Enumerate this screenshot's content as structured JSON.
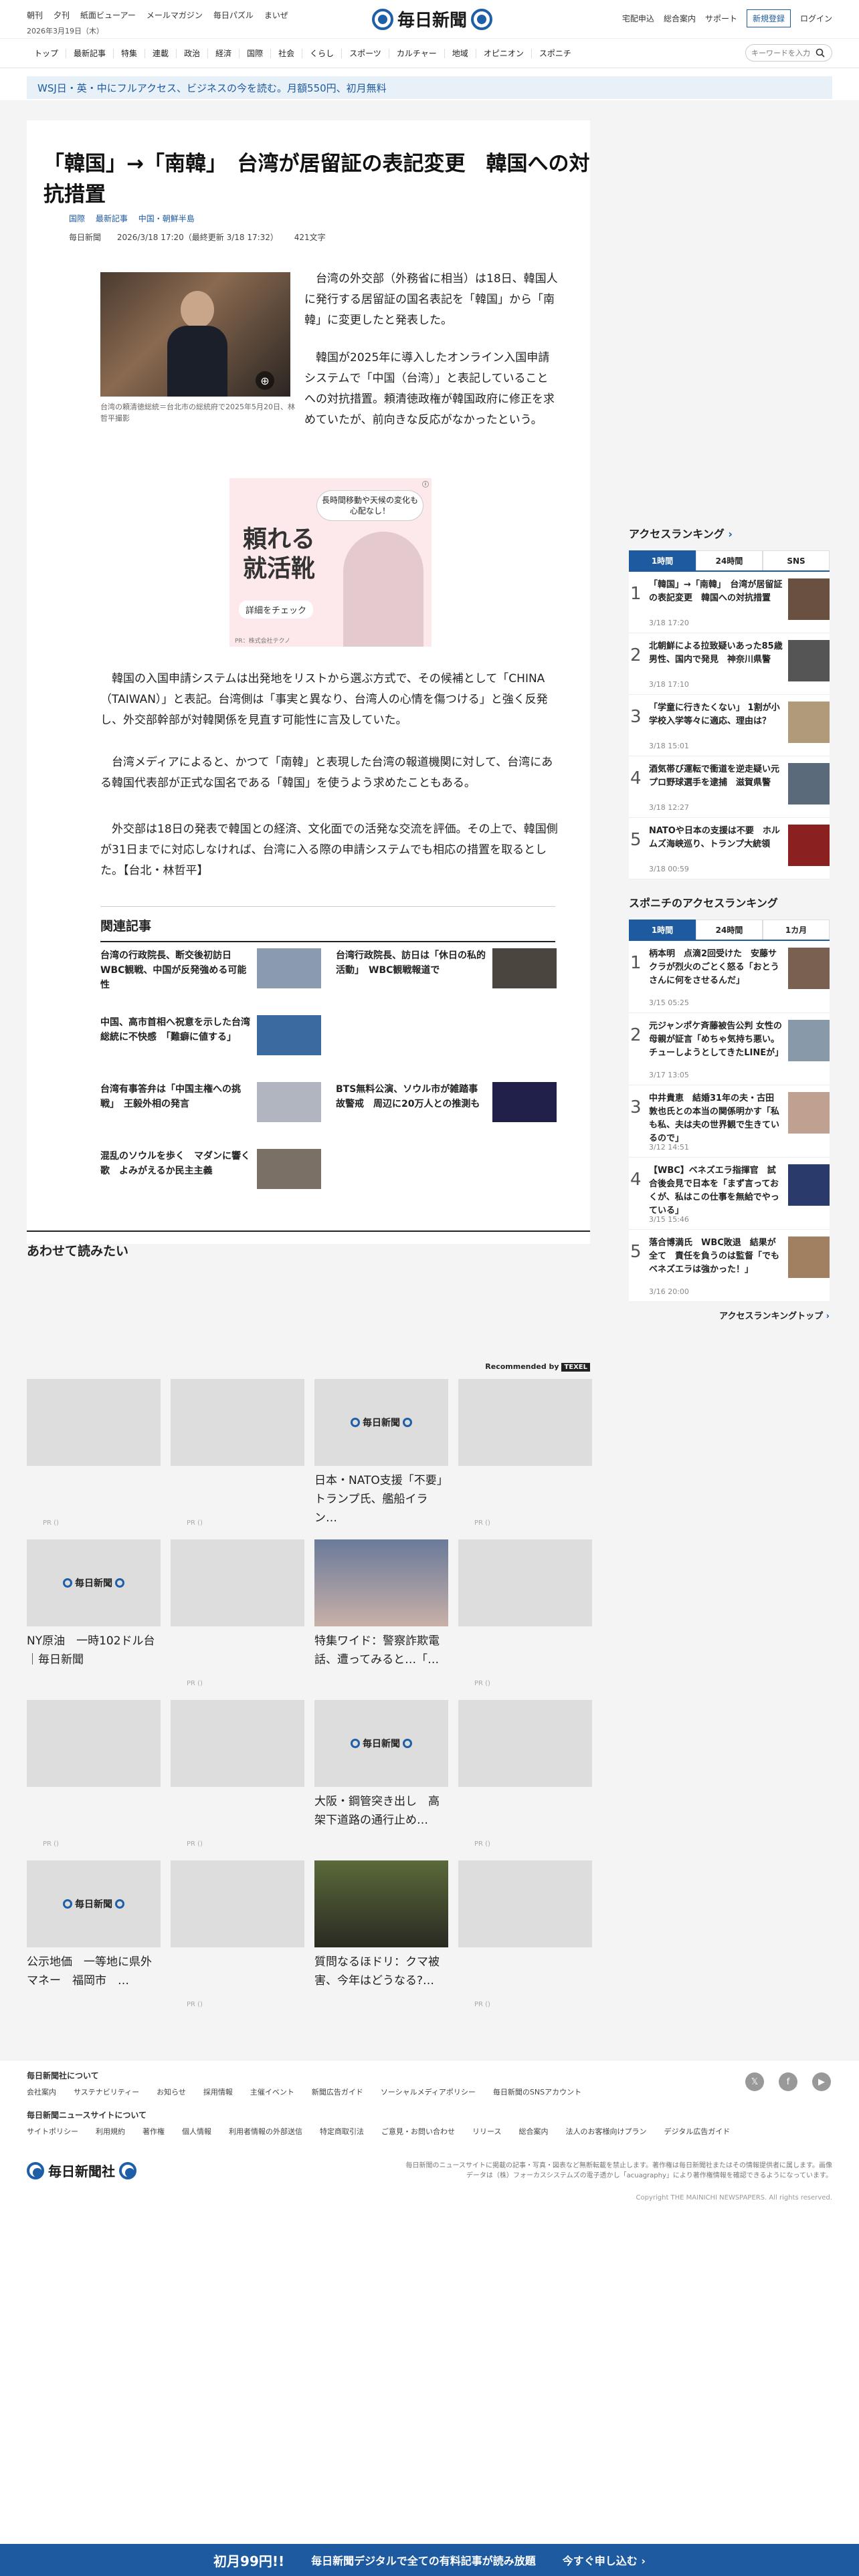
{
  "header": {
    "left_links": [
      "朝刊",
      "夕刊",
      "紙面ビューアー",
      "メールマガジン",
      "毎日パズル",
      "まいぜ"
    ],
    "date": "2026年3月19日（木）",
    "logo": "毎日新聞",
    "right_links": [
      "宅配申込",
      "総合案内",
      "サポート"
    ],
    "register": "新規登録",
    "login": "ログイン"
  },
  "nav": [
    "トップ",
    "最新記事",
    "特集",
    "連載",
    "政治",
    "経済",
    "国際",
    "社会",
    "くらし",
    "スポーツ",
    "カルチャー",
    "地域",
    "オピニオン",
    "スポニチ"
  ],
  "search": {
    "placeholder": "キーワードを入力"
  },
  "promo": "WSJ日・英・中にフルアクセス、ビジネスの今を読む。月額550円、初月無料",
  "article": {
    "title": "「韓国」→「南韓」　台湾が居留証の表記変更　韓国への対抗措置",
    "tags": [
      "国際",
      "最新記事",
      "中国・朝鮮半島"
    ],
    "source": "毎日新聞",
    "datetime": "2026/3/18 17:20（最終更新 3/18 17:32）",
    "chars": "421文字",
    "caption": "台湾の頼清徳総統＝台北市の総統府で2025年5月20日、林哲平撮影",
    "p1": "　台湾の外交部（外務省に相当）は18日、韓国人に発行する居留証の国名表記を「韓国」から「南韓」に変更したと発表した。",
    "p2": "　韓国が2025年に導入したオンライン入国申請システムで「中国（台湾）」と表記していることへの対抗措置。頼清徳政権が韓国政府に修正を求めていたが、前向きな反応がなかったという。",
    "p3": "　韓国の入国申請システムは出発地をリストから選ぶ方式で、その候補として「CHINA（TAIWAN）」と表記。台湾側は「事実と異なり、台湾人の心情を傷つける」と強く反発し、外交部幹部が対韓関係を見直す可能性に言及していた。",
    "p4": "　台湾メディアによると、かつて「南韓」と表現した台湾の報道機関に対して、台湾にある韓国代表部が正式な国名である「韓国」を使うよう求めたこともある。",
    "p5": "　外交部は18日の発表で韓国との経済、文化面での活発な交流を評価。その上で、韓国側が31日までに対応しなければ、台湾に入る際の申請システムでも相応の措置を取るとした。【台北・林哲平】"
  },
  "ad": {
    "bubble": "長時間移動や天候の変化も心配なし！",
    "title": "頼れる就活靴",
    "button": "詳細をチェック",
    "note": "PR：株式会社テクノ"
  },
  "related": {
    "heading": "関連記事",
    "items": [
      "台湾の行政院長、断交後初訪日 WBC観戦、中国が反発強める可能性",
      "台湾行政院長、訪日は「休日の私的活動」　WBC観戦報道で",
      "中国、高市首相へ祝意を示した台湾総統に不快感　「難癖に値する」",
      "台湾有事答弁は「中国主権への挑戦」　王毅外相の発言",
      "BTS無料公演、ソウル市が雑踏事故警戒　周辺に20万人との推測も",
      "混乱のソウルを歩く　マダンに響く歌　よみがえるか民主主義"
    ]
  },
  "ranking": {
    "heading": "アクセスランキング",
    "tabs": [
      "1時間",
      "24時間",
      "SNS"
    ],
    "items": [
      {
        "rank": "1",
        "title": "「韓国」→「南韓」　台湾が居留証の表記変更　韓国への対抗措置",
        "date": "3/18 17:20"
      },
      {
        "rank": "2",
        "title": "北朝鮮による拉致疑いあった85歳男性、国内で発見　神奈川県警",
        "date": "3/18 17:10"
      },
      {
        "rank": "3",
        "title": "「学童に行きたくない」 1割が小学校入学等々に適応、理由は？",
        "date": "3/18 15:01"
      },
      {
        "rank": "4",
        "title": "酒気帯び運転で衝道を逆走疑い元プロ野球選手を逮捕　滋賀県警",
        "date": "3/18 12:27"
      },
      {
        "rank": "5",
        "title": "NATOや日本の支援は不要　ホルムズ海峡巡り、トランプ大統領",
        "date": "3/18 00:59"
      }
    ],
    "heading2": "スポニチのアクセスランキング",
    "tabs2": [
      "1時間",
      "24時間",
      "1カ月"
    ],
    "items2": [
      {
        "rank": "1",
        "title": "柄本明　点滴2回受けた　安藤サクラが烈火のごとく怒る「おとうさんに何をさせるんだ」",
        "date": "3/15 05:25"
      },
      {
        "rank": "2",
        "title": "元ジャンポケ斉藤被告公判 女性の母親が証言「めちゃ気持ち悪い。チューしようとしてきたLINEが」",
        "date": "3/17 13:05"
      },
      {
        "rank": "3",
        "title": "中井貴恵　結婚31年の夫・古田敦也氏との本当の関係明かす「私も私、夫は夫の世界観で生きているので」",
        "date": "3/12 14:51"
      },
      {
        "rank": "4",
        "title": "【WBC】ベネズエラ指揮官　試合後会見で日本を「まず言っておくが、私はこの仕事を無給でやっている」",
        "date": "3/15 15:46"
      },
      {
        "rank": "5",
        "title": "落合博満氏　WBC敗退　結果が全て　責任を負うのは監督「でもベネズエラは強かった！」",
        "date": "3/16 20:00"
      }
    ],
    "more": "アクセスランキングトップ"
  },
  "readmore": {
    "heading": "あわせて読みたい",
    "recommended": "Recommended by",
    "recommended_brand": "TEXEL",
    "cards": [
      "日本・NATO支援「不要」トランプ氏、艦船イラン…",
      "NY原油　一時102ドル台｜毎日新聞",
      "特集ワイド：警察詐欺電話、遭ってみると…「…",
      "大阪・鋼管突き出し　高架下道路の通行止め…",
      "公示地価　一等地に県外マネー　福岡市　…",
      "質問なるほドリ：クマ被害、今年はどうなる?…"
    ],
    "pr": "PR ()"
  },
  "footer": {
    "about": "毎日新聞社について",
    "about_links": [
      "会社案内",
      "サステナビリティー",
      "お知らせ",
      "採用情報",
      "主催イベント",
      "新聞広告ガイド",
      "ソーシャルメディアポリシー",
      "毎日新聞のSNSアカウント"
    ],
    "news": "毎日新聞ニュースサイトについて",
    "news_links": [
      "サイトポリシー",
      "利用規約",
      "著作権",
      "個人情報",
      "利用者情報の外部送信",
      "特定商取引法",
      "ご意見・お問い合わせ",
      "リリース",
      "総合案内",
      "法人のお客様向けプラン",
      "デジタル広告ガイド"
    ],
    "logo": "毎日新聞社",
    "notice": "毎日新聞のニュースサイトに掲載の記事・写真・図表など無断転載を禁止します。著作権は毎日新聞社またはその情報提供者に属します。画像データは（株）フォーカスシステムズの電子透かし「acuagraphy」により著作権情報を確認できるようになっています。",
    "copyright": "Copyright THE MAINICHI NEWSPAPERS. All rights reserved."
  },
  "bottom": {
    "price": "初月99円!!",
    "text": "毎日新聞デジタルで全ての有料記事が読み放題",
    "cta": "今すぐ申し込む ›"
  }
}
